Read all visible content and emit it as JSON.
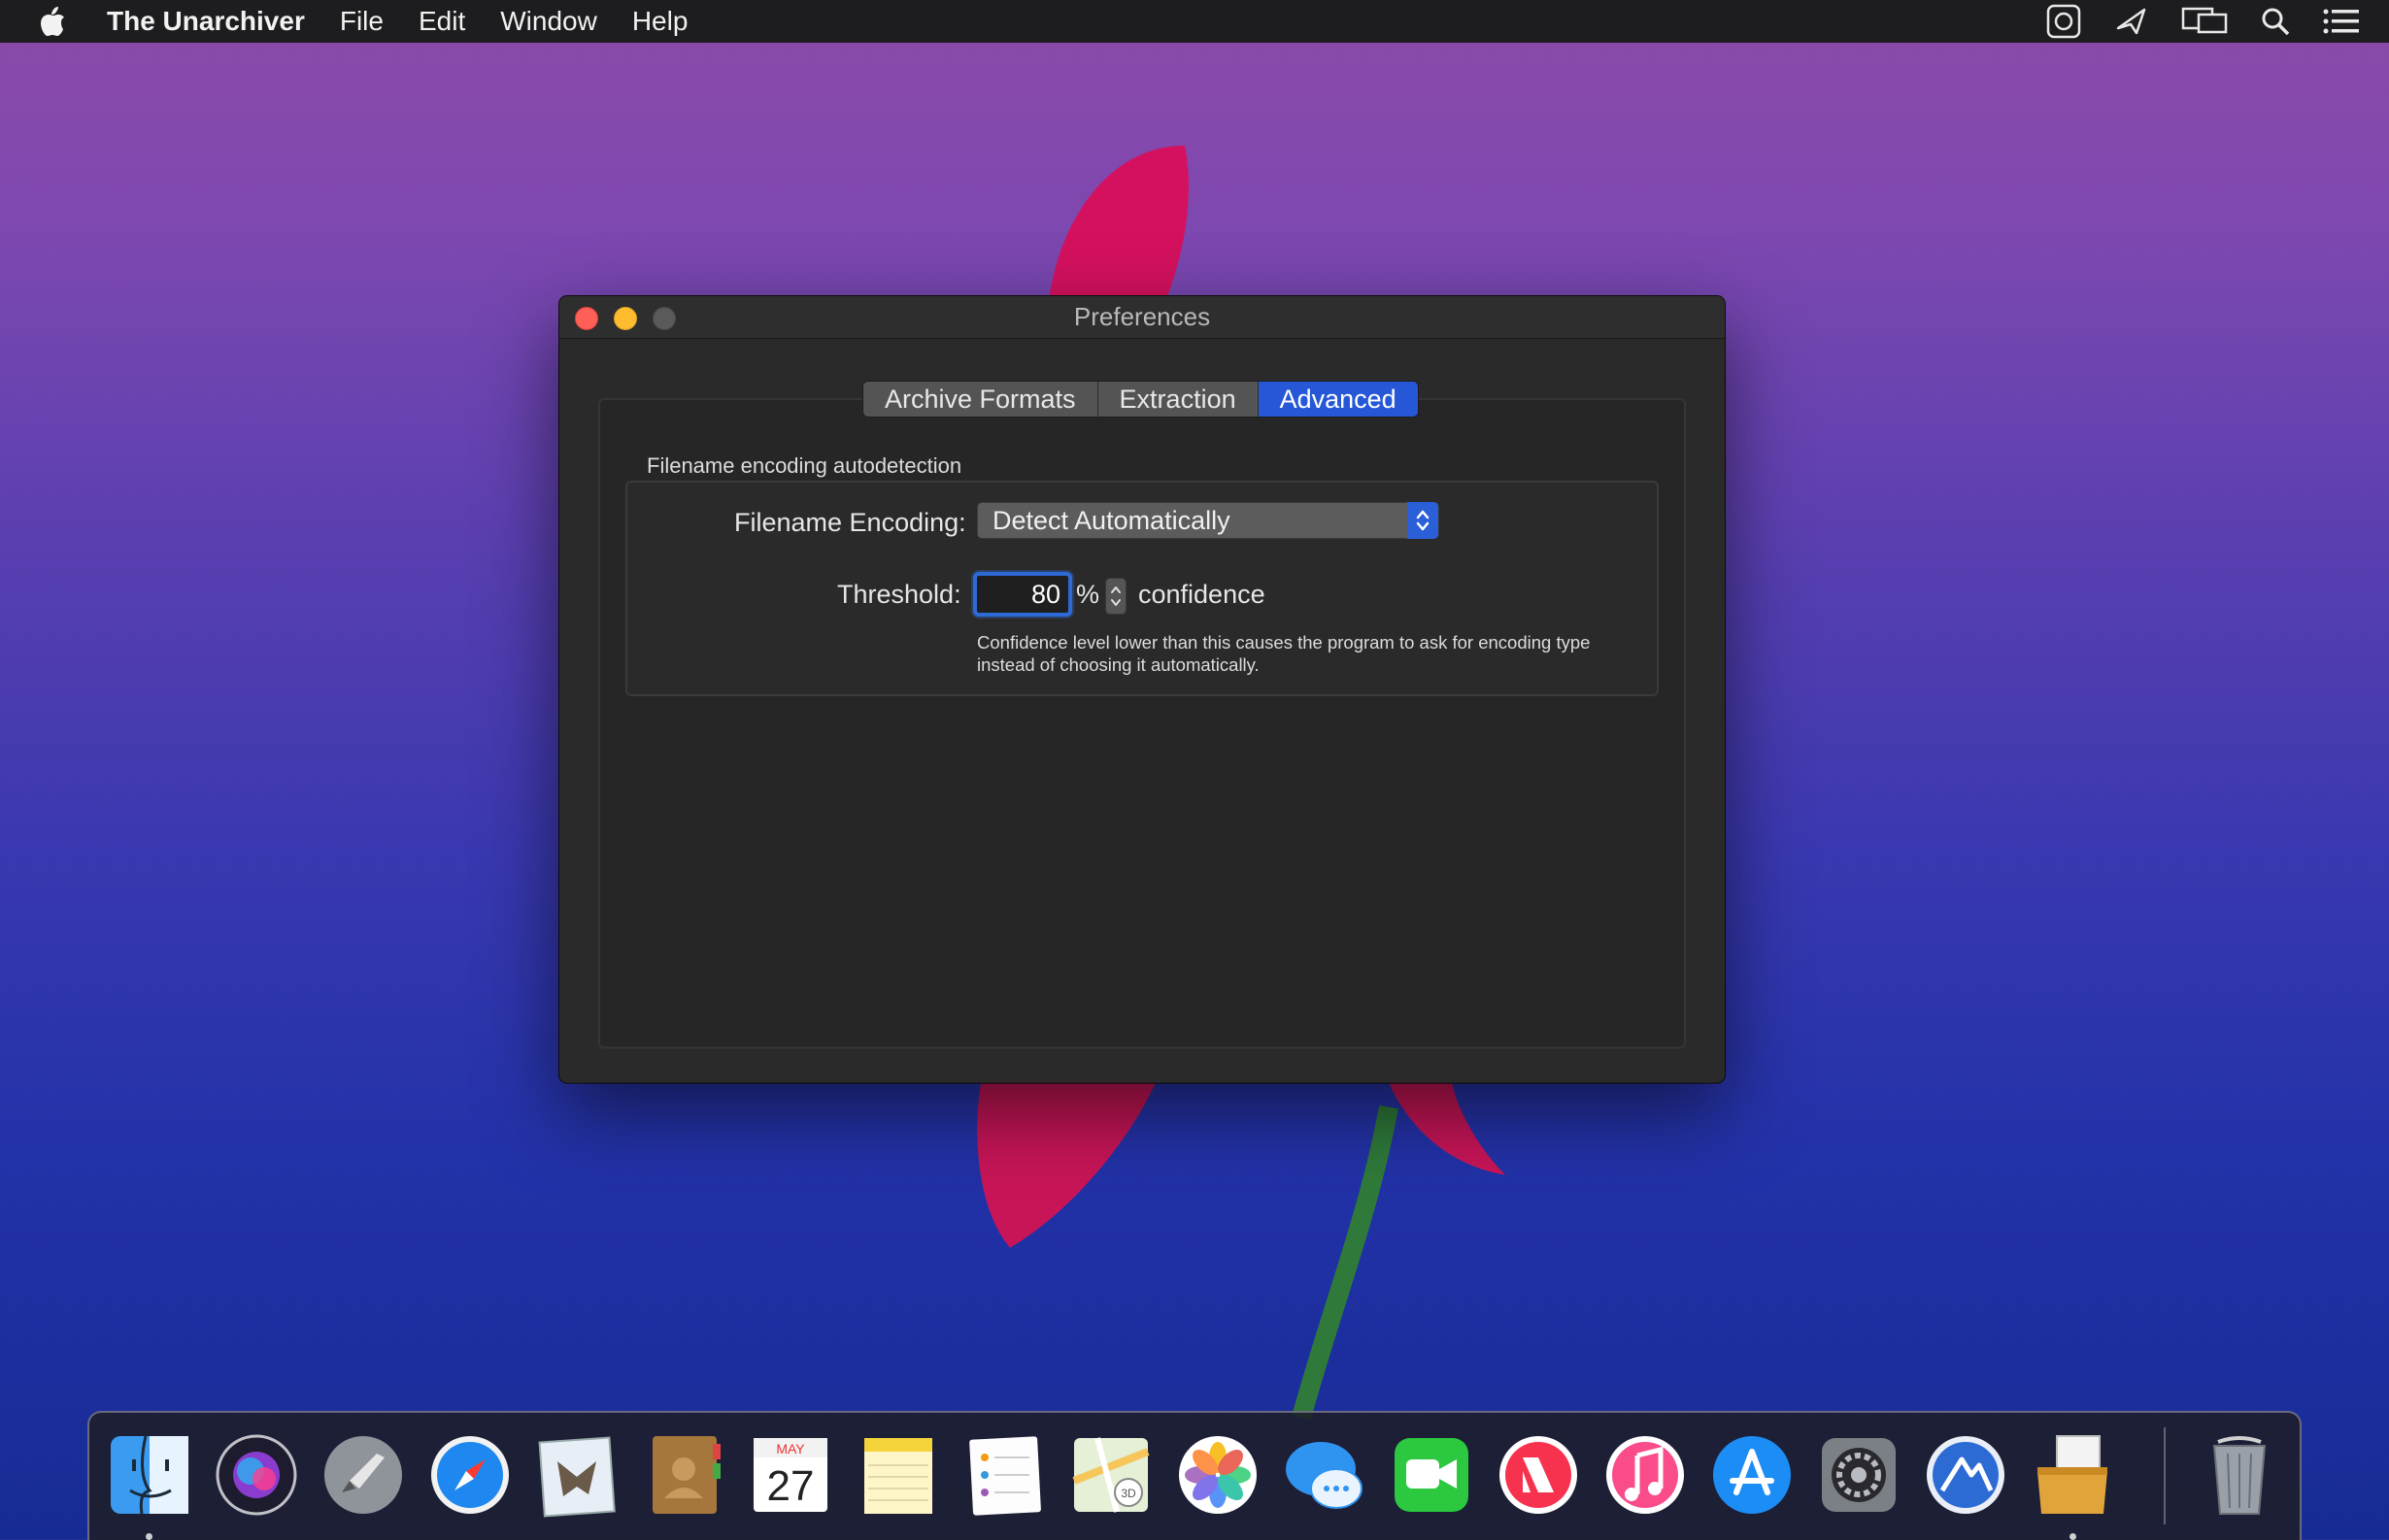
{
  "menubar": {
    "app_name": "The Unarchiver",
    "items": [
      "File",
      "Edit",
      "Window",
      "Help"
    ],
    "status_icons": [
      "screenshot-icon",
      "airplay-send-icon",
      "display-mirroring-icon",
      "spotlight-search-icon",
      "notification-center-icon"
    ]
  },
  "window": {
    "title": "Preferences",
    "tabs": [
      {
        "label": "Archive Formats",
        "active": false
      },
      {
        "label": "Extraction",
        "active": false
      },
      {
        "label": "Advanced",
        "active": true
      }
    ],
    "group_title": "Filename encoding autodetection",
    "encoding": {
      "label": "Filename Encoding:",
      "value": "Detect Automatically"
    },
    "threshold": {
      "label": "Threshold:",
      "value": "80",
      "unit": "%",
      "suffix": "confidence",
      "help": "Confidence level lower than this causes the program to ask for encoding type instead of choosing it automatically."
    }
  },
  "dock": {
    "items": [
      {
        "name": "finder",
        "running": true
      },
      {
        "name": "siri",
        "running": false
      },
      {
        "name": "launchpad",
        "running": false
      },
      {
        "name": "safari",
        "running": false
      },
      {
        "name": "mail",
        "running": false
      },
      {
        "name": "contacts",
        "running": false
      },
      {
        "name": "calendar",
        "running": false,
        "month": "MAY",
        "day": "27"
      },
      {
        "name": "notes",
        "running": false
      },
      {
        "name": "reminders",
        "running": false
      },
      {
        "name": "maps",
        "running": false
      },
      {
        "name": "photos",
        "running": false
      },
      {
        "name": "messages",
        "running": false
      },
      {
        "name": "facetime",
        "running": false
      },
      {
        "name": "news",
        "running": false
      },
      {
        "name": "music",
        "running": false
      },
      {
        "name": "app-store",
        "running": false
      },
      {
        "name": "system-preferences",
        "running": false
      },
      {
        "name": "instruments",
        "running": false
      },
      {
        "name": "the-unarchiver",
        "running": true
      },
      {
        "name": "trash",
        "running": false
      }
    ]
  },
  "colors": {
    "accent": "#2557d6",
    "menubar": "#1d1d1f",
    "window_bg": "#2a2a2a"
  }
}
